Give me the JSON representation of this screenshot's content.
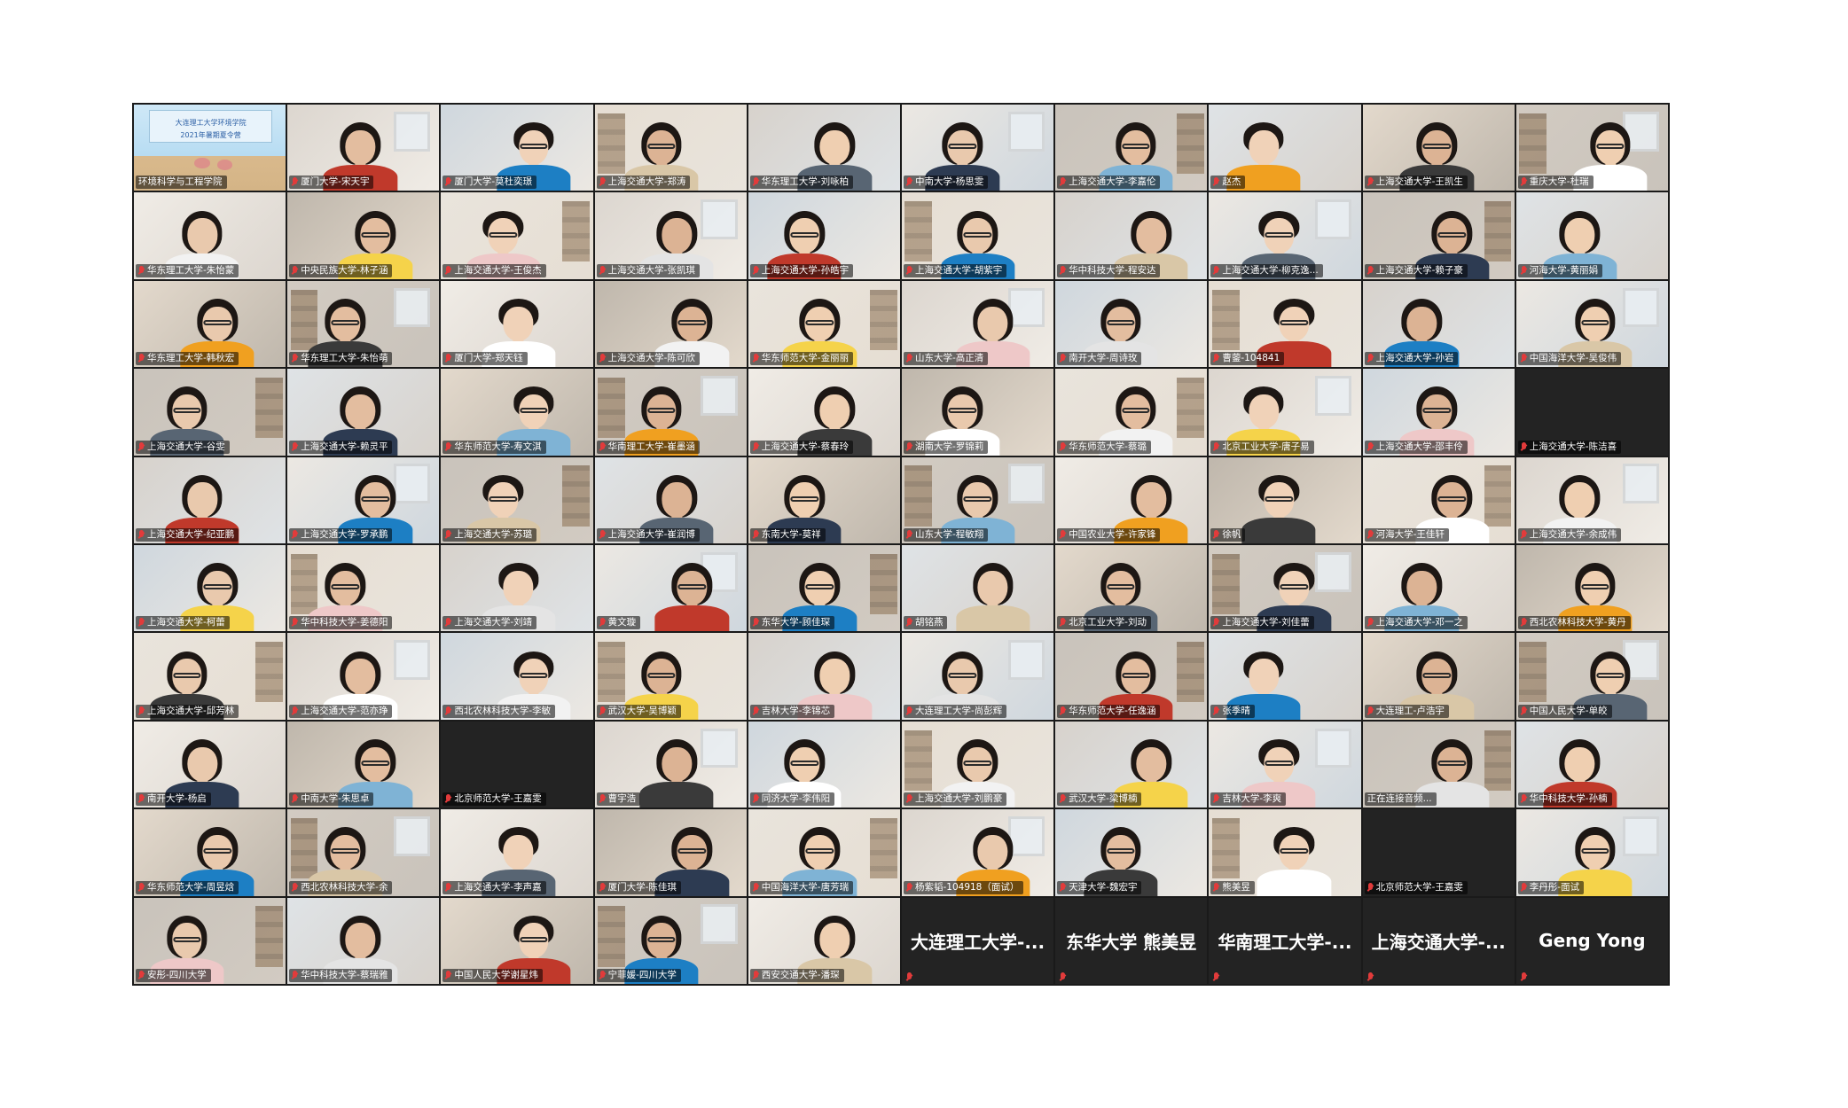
{
  "meeting": {
    "colors": {
      "gallery_bg": "#1a1a1a",
      "active_speaker": "#b4d63c",
      "muted_icon": "#e23b3b"
    },
    "tiles": [
      {
        "name": "环境科学与工程学院",
        "kind": "slide",
        "muted": false,
        "active": true,
        "slide_lines": [
          "大连理工大学环境学院",
          "2021年暑期夏令营"
        ]
      },
      {
        "name": "厦门大学-宋天宇",
        "kind": "video",
        "muted": true
      },
      {
        "name": "厦门大学-莫杜奕璟",
        "kind": "video",
        "muted": true
      },
      {
        "name": "上海交通大学-郑涛",
        "kind": "video",
        "muted": true
      },
      {
        "name": "华东理工大学-刘咏柏",
        "kind": "video",
        "muted": true
      },
      {
        "name": "中南大学-杨思雯",
        "kind": "video",
        "muted": true
      },
      {
        "name": "上海交通大学-李嘉伦",
        "kind": "video",
        "muted": true
      },
      {
        "name": "赵杰",
        "kind": "video",
        "muted": true
      },
      {
        "name": "上海交通大学-王凯生",
        "kind": "video",
        "muted": true
      },
      {
        "name": "重庆大学-杜瑞",
        "kind": "video",
        "muted": true
      },
      {
        "name": "华东理工大学-朱怡蒙",
        "kind": "video",
        "muted": true
      },
      {
        "name": "中央民族大学-林子涵",
        "kind": "video",
        "muted": true
      },
      {
        "name": "上海交通大学-王俊杰",
        "kind": "video",
        "muted": true
      },
      {
        "name": "上海交通大学-张凯琪",
        "kind": "video",
        "muted": true
      },
      {
        "name": "上海交通大学-孙皓宇",
        "kind": "video",
        "muted": true
      },
      {
        "name": "上海交通大学-胡紫宇",
        "kind": "video",
        "muted": true
      },
      {
        "name": "华中科技大学-程安达",
        "kind": "video",
        "muted": true
      },
      {
        "name": "上海交通大学-柳克逸...",
        "kind": "video",
        "muted": true
      },
      {
        "name": "上海交通大学-赖子豪",
        "kind": "video",
        "muted": true
      },
      {
        "name": "河海大学-黄丽娟",
        "kind": "video",
        "muted": true
      },
      {
        "name": "华东理工大学-韩秋宏",
        "kind": "video",
        "muted": true
      },
      {
        "name": "华东理工大学-朱怡萌",
        "kind": "video",
        "muted": true
      },
      {
        "name": "厦门大学-郑天钰",
        "kind": "video",
        "muted": true
      },
      {
        "name": "上海交通大学-陈可欣",
        "kind": "video",
        "muted": true
      },
      {
        "name": "华东师范大学-金丽丽",
        "kind": "video",
        "muted": true
      },
      {
        "name": "山东大学-高正清",
        "kind": "video",
        "muted": true
      },
      {
        "name": "南开大学-周诗玫",
        "kind": "video",
        "muted": true
      },
      {
        "name": "曹蓥-104841",
        "kind": "video",
        "muted": true
      },
      {
        "name": "上海交通大学-孙岩",
        "kind": "video",
        "muted": true
      },
      {
        "name": "中国海洋大学-吴俊伟",
        "kind": "video",
        "muted": true
      },
      {
        "name": "上海交通大学-谷雯",
        "kind": "video",
        "muted": true
      },
      {
        "name": "上海交通大学-赖灵平",
        "kind": "video",
        "muted": true
      },
      {
        "name": "华东师范大学-寿文淇",
        "kind": "video",
        "muted": true
      },
      {
        "name": "华南理工大学-崔墨涵",
        "kind": "video",
        "muted": true
      },
      {
        "name": "上海交通大学-蔡春玲",
        "kind": "video",
        "muted": true
      },
      {
        "name": "湖南大学-罗锦莉",
        "kind": "video",
        "muted": true
      },
      {
        "name": "华东师范大学-蔡璐",
        "kind": "video",
        "muted": true
      },
      {
        "name": "北京工业大学-唐子易",
        "kind": "video",
        "muted": true
      },
      {
        "name": "上海交通大学-邵丰伶",
        "kind": "video",
        "muted": true
      },
      {
        "name": "上海交通大学-陈洁喜",
        "kind": "dark",
        "muted": true,
        "center": ""
      },
      {
        "name": "上海交通大学-纪亚鹏",
        "kind": "video",
        "muted": true
      },
      {
        "name": "上海交通大学-罗承鹏",
        "kind": "video",
        "muted": true
      },
      {
        "name": "上海交通大学-苏璐",
        "kind": "video",
        "muted": true
      },
      {
        "name": "上海交通大学-崔润博",
        "kind": "video",
        "muted": true
      },
      {
        "name": "东南大学-莫祥",
        "kind": "video",
        "muted": true
      },
      {
        "name": "山东大学-程敏翔",
        "kind": "video",
        "muted": true
      },
      {
        "name": "中国农业大学-许家锋",
        "kind": "video",
        "muted": true
      },
      {
        "name": "徐帆",
        "kind": "video",
        "muted": true
      },
      {
        "name": "河海大学-王佳轩",
        "kind": "video",
        "muted": true
      },
      {
        "name": "上海交通大学-余成伟",
        "kind": "video",
        "muted": true
      },
      {
        "name": "上海交通大学-柯蕾",
        "kind": "video",
        "muted": true
      },
      {
        "name": "华中科技大学-姜德阳",
        "kind": "video",
        "muted": true
      },
      {
        "name": "上海交通大学-刘靖",
        "kind": "video",
        "muted": true
      },
      {
        "name": "黄文璇",
        "kind": "video",
        "muted": true
      },
      {
        "name": "东华大学-顾佳琛",
        "kind": "video",
        "muted": true
      },
      {
        "name": "胡铭燕",
        "kind": "video",
        "muted": true
      },
      {
        "name": "北京工业大学-刘动",
        "kind": "video",
        "muted": true
      },
      {
        "name": "上海交通大学-刘佳蕾",
        "kind": "video",
        "muted": true
      },
      {
        "name": "上海交通大学-邓一之",
        "kind": "video",
        "muted": true
      },
      {
        "name": "西北农林科技大学-黄丹",
        "kind": "video",
        "muted": true
      },
      {
        "name": "上海交通大学-邱芳林",
        "kind": "video",
        "muted": true
      },
      {
        "name": "上海交通大学-范亦琤",
        "kind": "video",
        "muted": true
      },
      {
        "name": "西北农林科技大学-李敏",
        "kind": "video",
        "muted": true
      },
      {
        "name": "武汉大学-吴博颖",
        "kind": "video",
        "muted": true
      },
      {
        "name": "吉林大学-李锦芯",
        "kind": "video",
        "muted": true
      },
      {
        "name": "大连理工大学-尚彭辉",
        "kind": "video",
        "muted": true
      },
      {
        "name": "华东师范大学-任逸涵",
        "kind": "video",
        "muted": true
      },
      {
        "name": "张季晴",
        "kind": "video",
        "muted": true
      },
      {
        "name": "大连理工-卢浩宇",
        "kind": "video",
        "muted": true
      },
      {
        "name": "中国人民大学-单皎",
        "kind": "video",
        "muted": true
      },
      {
        "name": "南开大学-杨启",
        "kind": "video",
        "muted": true
      },
      {
        "name": "中南大学-朱思卓",
        "kind": "video",
        "muted": true
      },
      {
        "name": "北京师范大学-王嘉雯",
        "kind": "dark",
        "muted": true,
        "center": ""
      },
      {
        "name": "曹宇浩",
        "kind": "video",
        "muted": true
      },
      {
        "name": "同济大学-李伟阳",
        "kind": "video",
        "muted": true
      },
      {
        "name": "上海交通大学-刘鹏豪",
        "kind": "video",
        "muted": true
      },
      {
        "name": "武汉大学-梁博楠",
        "kind": "video",
        "muted": true
      },
      {
        "name": "吉林大学-李爽",
        "kind": "video",
        "muted": true
      },
      {
        "name": "正在连接音频...",
        "kind": "video",
        "muted": false
      },
      {
        "name": "华中科技大学-孙楠",
        "kind": "video",
        "muted": true
      },
      {
        "name": "华东师范大学-周昱焓",
        "kind": "video",
        "muted": true
      },
      {
        "name": "西北农林科技大学-余",
        "kind": "video",
        "muted": true
      },
      {
        "name": "上海交通大学-李声嘉",
        "kind": "video",
        "muted": true
      },
      {
        "name": "厦门大学-陈佳琪",
        "kind": "video",
        "muted": true
      },
      {
        "name": "中国海洋大学-唐芳瑞",
        "kind": "video",
        "muted": true
      },
      {
        "name": "杨紫韬-104918（面试）",
        "kind": "video",
        "muted": true
      },
      {
        "name": "天津大学-魏宏宇",
        "kind": "video",
        "muted": true
      },
      {
        "name": "熊美昱",
        "kind": "video",
        "muted": true
      },
      {
        "name": "北京师范大学-王嘉雯",
        "kind": "dark",
        "muted": true,
        "center": ""
      },
      {
        "name": "李丹彤-面试",
        "kind": "video",
        "muted": true
      },
      {
        "name": "安彤-四川大学",
        "kind": "video",
        "muted": true
      },
      {
        "name": "华中科技大学-蔡瑞雅",
        "kind": "video",
        "muted": true
      },
      {
        "name": "中国人民大学谢星炜",
        "kind": "video",
        "muted": true
      },
      {
        "name": "宁菲媛-四川大学",
        "kind": "video",
        "muted": true
      },
      {
        "name": "西安交通大学-潘琛",
        "kind": "video",
        "muted": true
      },
      {
        "name": "",
        "kind": "dark",
        "muted": true,
        "center": "大连理工大学-..."
      },
      {
        "name": "",
        "kind": "dark",
        "muted": true,
        "center": "东华大学 熊美昱"
      },
      {
        "name": "",
        "kind": "dark",
        "muted": true,
        "center": "华南理工大学-..."
      },
      {
        "name": "",
        "kind": "dark",
        "muted": true,
        "center": "上海交通大学-..."
      },
      {
        "name": "",
        "kind": "dark",
        "muted": true,
        "center": "Geng Yong"
      }
    ]
  }
}
